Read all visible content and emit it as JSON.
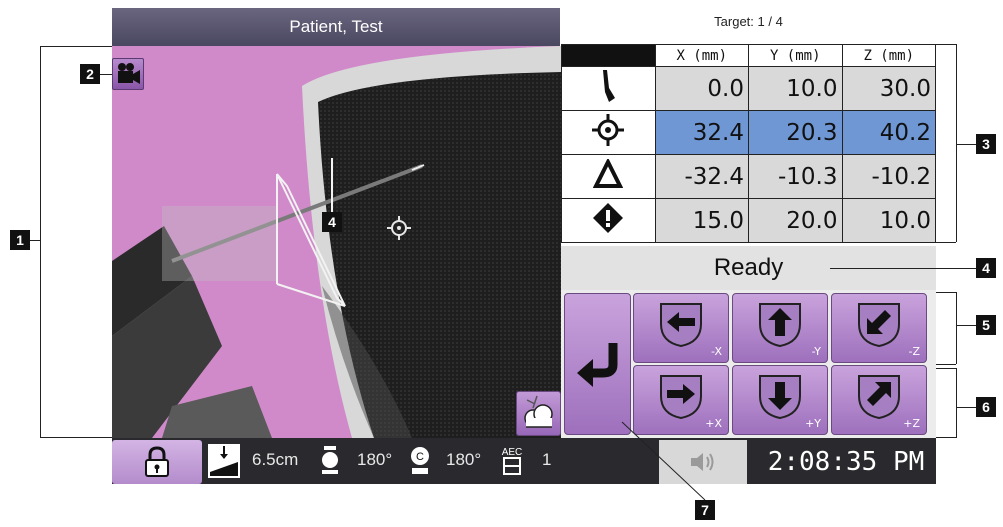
{
  "header": {
    "patient_name": "Patient, Test"
  },
  "target": {
    "label": "Target:",
    "value": "1 / 4"
  },
  "table": {
    "columns": [
      "X (mm)",
      "Y (mm)",
      "Z (mm)"
    ],
    "rows": [
      {
        "icon": "needle-icon",
        "values": [
          "0.0",
          "10.0",
          "30.0"
        ]
      },
      {
        "icon": "crosshair-target-icon",
        "values": [
          "32.4",
          "20.3",
          "40.2"
        ]
      },
      {
        "icon": "delta-icon",
        "values": [
          "-32.4",
          "-10.3",
          "-10.2"
        ]
      },
      {
        "icon": "warning-diamond-icon",
        "values": [
          "15.0",
          "20.0",
          "10.0"
        ]
      }
    ]
  },
  "status": "Ready",
  "motion": {
    "back_icon": "return-arrow-icon",
    "buttons": [
      "-X",
      "-Y",
      "-Z",
      "+X",
      "+Y",
      "+Z"
    ]
  },
  "view": {
    "needle_marker": "4"
  },
  "footer": {
    "compression": "6.5cm",
    "angle_1": "180°",
    "angle_2": "180°",
    "aec_value": "1",
    "clock": "2:08:35 PM"
  },
  "callouts": [
    "1",
    "2",
    "3",
    "4",
    "5",
    "6",
    "7"
  ],
  "colors": {
    "accent_purple": "#b48ccc",
    "selected_row": "#6f97d4",
    "view_background": "#d08ac9",
    "footer_background": "#2a2a2e"
  }
}
